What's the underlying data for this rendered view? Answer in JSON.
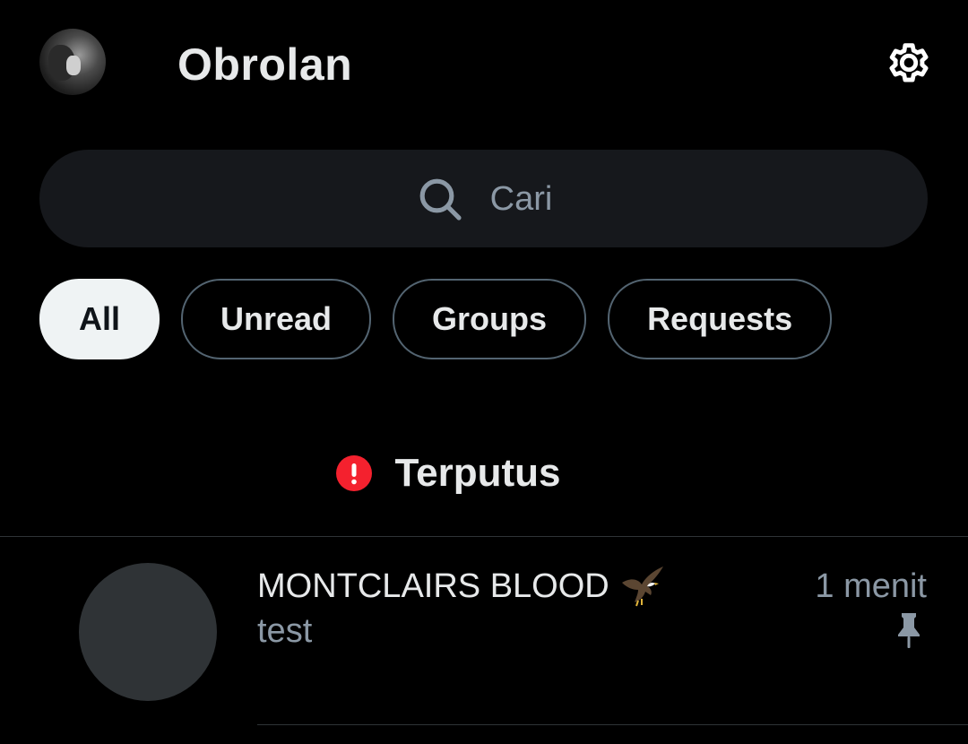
{
  "header": {
    "title": "Obrolan",
    "avatar_icon": "profile-avatar",
    "settings_icon": "gear-icon"
  },
  "search": {
    "placeholder": "Cari",
    "icon": "search-icon"
  },
  "filters": [
    {
      "label": "All",
      "active": true
    },
    {
      "label": "Unread",
      "active": false
    },
    {
      "label": "Groups",
      "active": false
    },
    {
      "label": "Requests",
      "active": false
    }
  ],
  "status": {
    "text": "Terputus",
    "icon": "alert-icon",
    "color": "#f4212e"
  },
  "conversations": [
    {
      "name": "MONTCLAIRS BLOOD",
      "name_emoji": "eagle-icon",
      "preview": "test",
      "time": "1 menit",
      "pinned": true
    }
  ],
  "colors": {
    "background": "#000000",
    "text": "#e7e9ea",
    "muted": "#8b98a5",
    "search_bg": "#16181c",
    "chip_border": "#536471",
    "chip_active_bg": "#eff3f4",
    "alert": "#f4212e"
  }
}
